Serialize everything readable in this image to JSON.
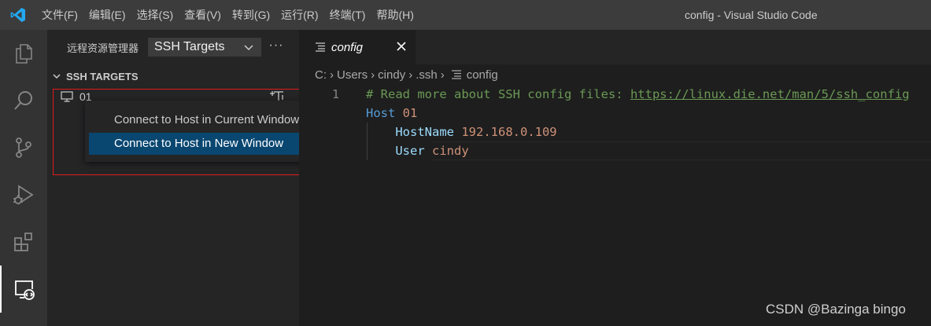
{
  "window": {
    "title": "config - Visual Studio Code",
    "menu": [
      "文件(F)",
      "编辑(E)",
      "选择(S)",
      "查看(V)",
      "转到(G)",
      "运行(R)",
      "终端(T)",
      "帮助(H)"
    ]
  },
  "activity_bar": {
    "icons": [
      "explorer-icon",
      "search-icon",
      "source-control-icon",
      "run-debug-icon",
      "extensions-icon",
      "remote-explorer-icon"
    ],
    "active": "remote-explorer-icon"
  },
  "sidebar": {
    "title": "远程资源管理器",
    "target_select": "SSH Targets",
    "more": "···",
    "section_title": "SSH TARGETS",
    "host_label": "01"
  },
  "context_menu": {
    "items": [
      "Connect to Host in Current Window",
      "Connect to Host in New Window"
    ],
    "highlighted": "Connect to Host in New Window"
  },
  "editor": {
    "tab_label": "config",
    "breadcrumb": [
      "C:",
      "Users",
      "cindy",
      ".ssh",
      "config"
    ],
    "line_number": "1",
    "code": {
      "comment": "# Read more about SSH config files: ",
      "link": "https://linux.die.net/man/5/ssh_config",
      "host_key": "Host",
      "host_val": "01",
      "hostname_key": "HostName",
      "hostname_val": "192.168.0.109",
      "user_key": "User",
      "user_val": "cindy"
    }
  },
  "watermark": "CSDN @Bazinga bingo",
  "colors": {
    "titlebar": "#3c3c3c",
    "activitybar": "#333333",
    "sidebar": "#252526",
    "editor": "#1e1e1e",
    "menu_highlight": "#094771",
    "annotation_box": "#e01b1b",
    "vscode_blue": "#23a9f2"
  }
}
